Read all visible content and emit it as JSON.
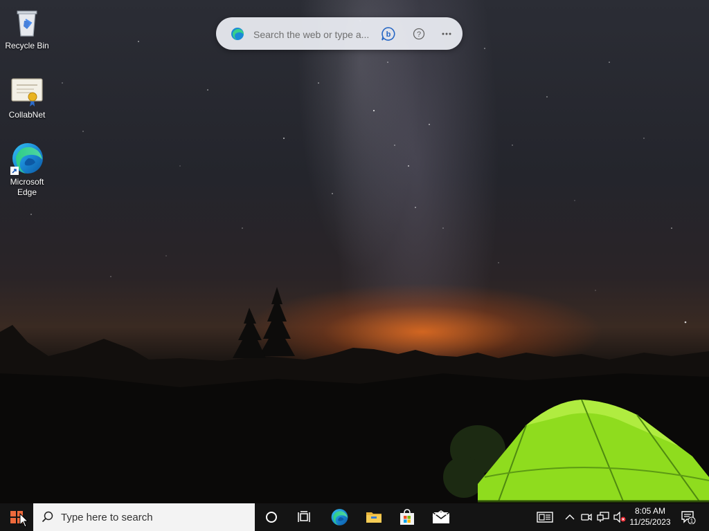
{
  "desktop": {
    "icons": [
      {
        "label": "Recycle Bin",
        "icon": "recycle-bin-icon"
      },
      {
        "label": "CollabNet",
        "icon": "certificate-icon"
      },
      {
        "label": "Microsoft Edge",
        "icon": "edge-icon"
      }
    ]
  },
  "edge_search": {
    "placeholder": "Search the web or type a...",
    "logo_icon": "bing-icon",
    "buttons": [
      "bing-chat-icon",
      "help-icon",
      "more-icon"
    ]
  },
  "taskbar": {
    "start_icon": "windows-start-icon",
    "search_placeholder": "Type here to search",
    "pinned": [
      "cortana-icon",
      "task-view-icon",
      "edge-icon",
      "file-explorer-icon",
      "microsoft-store-icon",
      "mail-icon"
    ],
    "tray": [
      "news-widget-icon",
      "show-hidden-icons-chevron",
      "meet-now-icon",
      "network-icon",
      "volume-muted-icon"
    ],
    "clock": {
      "time": "8:05 AM",
      "date": "11/25/2023"
    },
    "notification_count": "1"
  },
  "colors": {
    "taskbar": "#141414",
    "search_box": "#f3f3f3",
    "tent_green": "#8fdc1e",
    "horizon_orange": "#e86e1e"
  }
}
